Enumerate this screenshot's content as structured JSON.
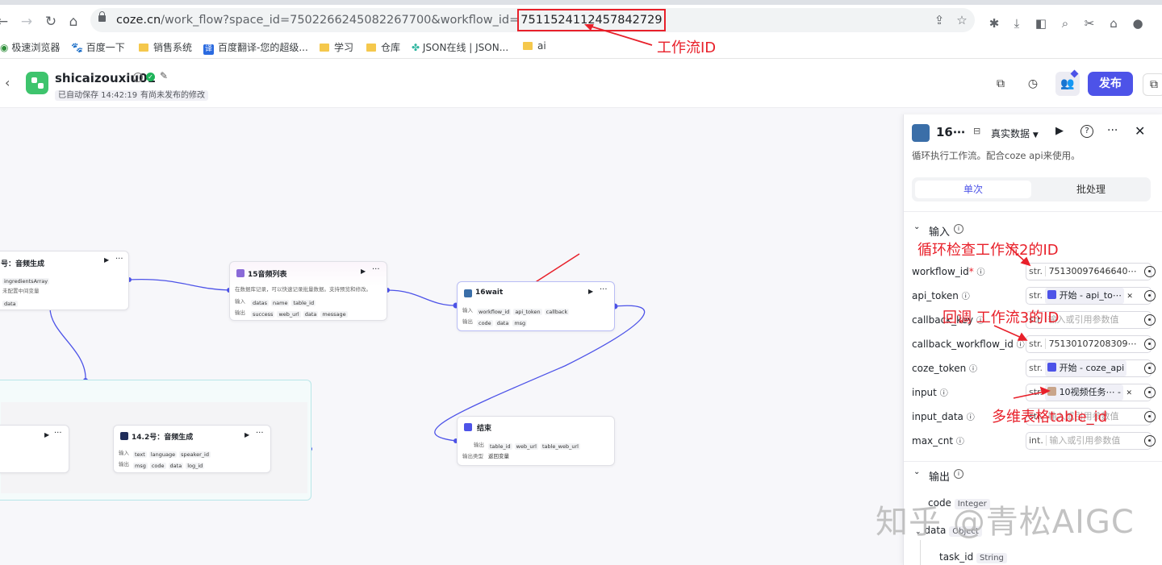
{
  "browser": {
    "url_host": "coze.cn",
    "url_path": "/work_flow?space_id=7502266245082267700&workflow_id=",
    "url_workflow_id": "7511524112457842729",
    "bookmarks": [
      "极速浏览器",
      "百度一下",
      "销售系统",
      "百度翻译-您的超级...",
      "学习",
      "仓库",
      "JSON在线 | JSON...",
      "ai"
    ]
  },
  "header": {
    "title": "shicaizouxiu01",
    "autosave": "已自动保存 14:42:19",
    "unpublished": "有尚未发布的修改",
    "publish_label": "发布"
  },
  "canvas": {
    "node_audio_gen": {
      "title": "号：音频生成",
      "param1": "ingredientsArray",
      "note": "未配置中间变量",
      "output": "data"
    },
    "node_15": {
      "title": "15音频列表",
      "desc": "在数据库记录，可以快速记录批量数据。支持预览和修改。",
      "in_label": "输入",
      "out_label": "输出",
      "inputs": [
        "datas",
        "name",
        "table_id"
      ],
      "outputs": [
        "success",
        "web_url",
        "data",
        "message"
      ]
    },
    "node_16": {
      "title": "16wait",
      "in_label": "输入",
      "out_label": "输出",
      "inputs": [
        "workflow_id",
        "api_token",
        "callback"
      ],
      "outputs": [
        "code",
        "data",
        "msg"
      ]
    },
    "node_14_2": {
      "title": "14.2号：音频生成",
      "in_label": "输入",
      "out_label": "输出",
      "inputs": [
        "text",
        "language",
        "speaker_id"
      ],
      "outputs": [
        "msg",
        "code",
        "data",
        "log_id"
      ]
    },
    "node_end": {
      "title": "结束",
      "out_label": "输出",
      "outputs": [
        "table_id",
        "web_url",
        "table_web_url"
      ],
      "mode_label": "输出类型",
      "mode_value": "返回变量"
    }
  },
  "panel": {
    "title": "16⋯",
    "data_mode": "真实数据",
    "desc": "循环执行工作流。配合coze api来使用。",
    "tab_single": "单次",
    "tab_batch": "批处理",
    "section_input": "输入",
    "section_output": "输出",
    "rows": [
      {
        "name": "workflow_id",
        "required": "*",
        "type": "str.",
        "value": "75130097646640⋯"
      },
      {
        "name": "api_token",
        "required": "",
        "type": "str.",
        "ref": "开始 - api_to⋯"
      },
      {
        "name": "callback_key",
        "required": "",
        "type": "str.",
        "placeholder": "输入或引用参数值"
      },
      {
        "name": "callback_workflow_id",
        "required": "",
        "type": "str.",
        "value": "75130107208309⋯"
      },
      {
        "name": "coze_token",
        "required": "",
        "type": "str.",
        "ref": "开始 - coze_api"
      },
      {
        "name": "input",
        "required": "",
        "type": "str.",
        "ref": "10视频任务⋯ -"
      },
      {
        "name": "input_data",
        "required": "",
        "type": "str.",
        "placeholder": "输入或引用参数值"
      },
      {
        "name": "max_cnt",
        "required": "",
        "type": "int.",
        "placeholder": "输入或引用参数值"
      }
    ],
    "outputs": [
      {
        "name": "code",
        "type": "Integer"
      },
      {
        "name": "data",
        "type": "Object"
      },
      {
        "name": "task_id",
        "type": "String"
      }
    ]
  },
  "annotations": {
    "workflow_id": "工作流ID",
    "loop_check": "循环检查工作流2的ID",
    "callback": "回调 工作流3的ID",
    "table": "多维表格table_id"
  },
  "watermark": "知乎 @青松AIGC",
  "colors": {
    "accent": "#4d53e8",
    "annotation": "#e8202a",
    "logo": "#3ec46d"
  }
}
